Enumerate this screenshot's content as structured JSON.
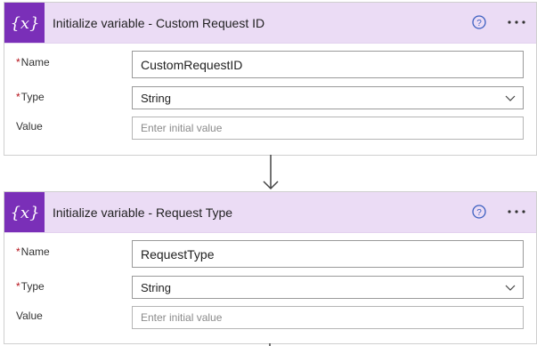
{
  "cards": [
    {
      "title": "Initialize variable - Custom Request ID",
      "icon_label": "{x}",
      "fields": {
        "name_label": "Name",
        "name_value": "CustomRequestID",
        "type_label": "Type",
        "type_value": "String",
        "value_label": "Value",
        "value_placeholder": "Enter initial value"
      }
    },
    {
      "title": "Initialize variable - Request Type",
      "icon_label": "{x}",
      "fields": {
        "name_label": "Name",
        "name_value": "RequestType",
        "type_label": "Type",
        "type_value": "String",
        "value_label": "Value",
        "value_placeholder": "Enter initial value"
      }
    }
  ],
  "required_marker": "*",
  "colors": {
    "header_bg": "#ebdcf5",
    "icon_bg": "#7a2fb8",
    "help_icon": "#3b5fc0",
    "required": "#b5121b"
  },
  "icons": [
    "variable-icon",
    "help-icon",
    "more-options-icon",
    "chevron-down-icon",
    "down-arrow-icon"
  ]
}
